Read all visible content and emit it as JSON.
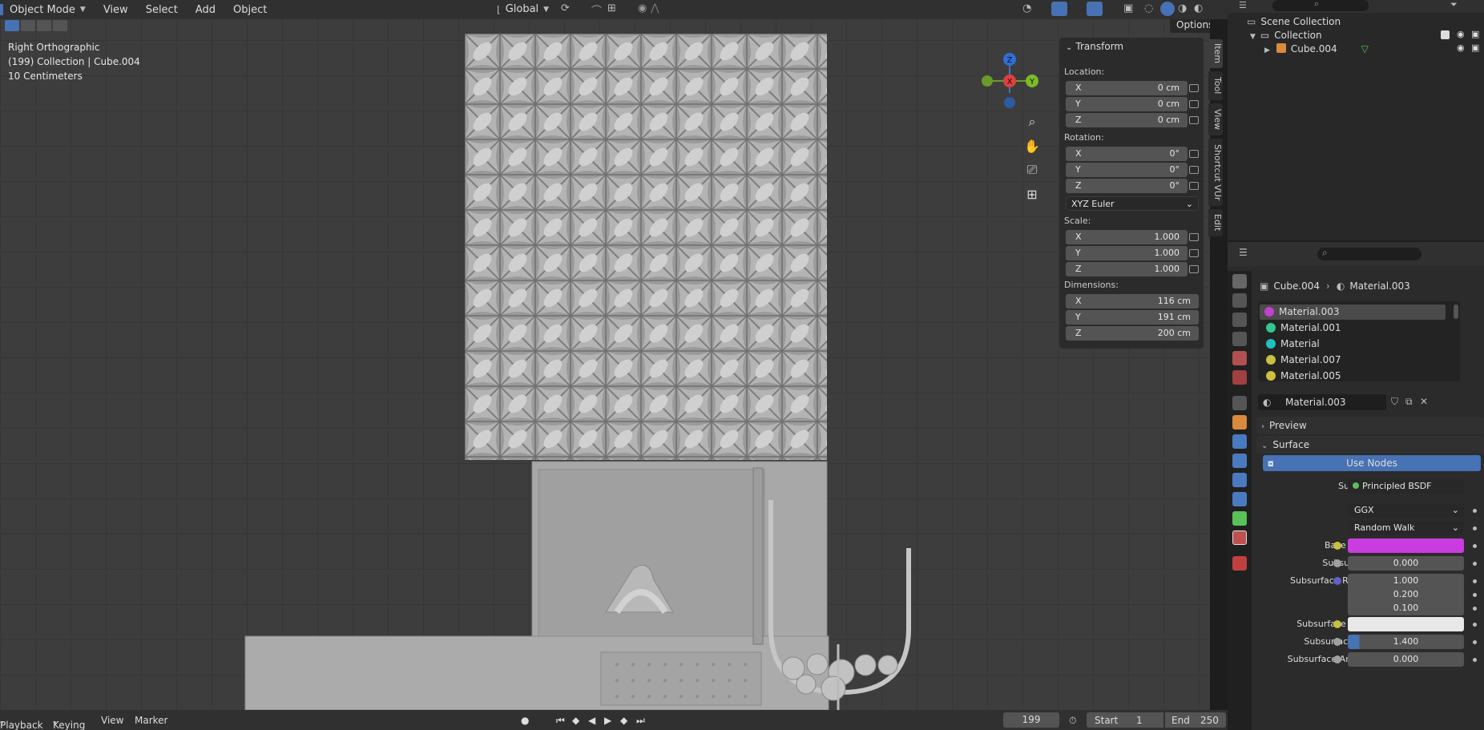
{
  "header": {
    "mode": "Object Mode",
    "menus": [
      "View",
      "Select",
      "Add",
      "Object"
    ],
    "orientation": "Global",
    "options_label": "Options"
  },
  "viewport": {
    "view_name": "Right Orthographic",
    "collection_info": "(199) Collection | Cube.004",
    "scale_info": "10 Centimeters",
    "axes": {
      "z": "Z",
      "x": "X",
      "y": "Y"
    }
  },
  "npanel": {
    "title": "Transform",
    "location_label": "Location:",
    "location": [
      {
        "axis": "X",
        "value": "0 cm"
      },
      {
        "axis": "Y",
        "value": "0 cm"
      },
      {
        "axis": "Z",
        "value": "0 cm"
      }
    ],
    "rotation_label": "Rotation:",
    "rotation": [
      {
        "axis": "X",
        "value": "0°"
      },
      {
        "axis": "Y",
        "value": "0°"
      },
      {
        "axis": "Z",
        "value": "0°"
      }
    ],
    "rotation_mode": "XYZ Euler",
    "scale_label": "Scale:",
    "scale": [
      {
        "axis": "X",
        "value": "1.000"
      },
      {
        "axis": "Y",
        "value": "1.000"
      },
      {
        "axis": "Z",
        "value": "1.000"
      }
    ],
    "dimensions_label": "Dimensions:",
    "dimensions": [
      {
        "axis": "X",
        "value": "116 cm"
      },
      {
        "axis": "Y",
        "value": "191 cm"
      },
      {
        "axis": "Z",
        "value": "200 cm"
      }
    ],
    "tabs": [
      "Item",
      "Tool",
      "View",
      "Shortcut VUr",
      "Edit"
    ]
  },
  "outliner": {
    "scene_collection": "Scene Collection",
    "collection": "Collection",
    "object": "Cube.004"
  },
  "properties": {
    "breadcrumb_object": "Cube.004",
    "breadcrumb_material": "Material.003",
    "materials": [
      {
        "name": "Material.003",
        "color": "#c040d0"
      },
      {
        "name": "Material.001",
        "color": "#30c890"
      },
      {
        "name": "Material",
        "color": "#20c0c0"
      },
      {
        "name": "Material.007",
        "color": "#c8c040"
      },
      {
        "name": "Material.005",
        "color": "#d0c040"
      }
    ],
    "active_material": "Material.003",
    "preview_label": "Preview",
    "surface_panel_label": "Surface",
    "use_nodes_label": "Use Nodes",
    "surface_label": "Surface",
    "surface_shader": "Principled BSDF",
    "distribution": "GGX",
    "subsurface_method": "Random Walk",
    "base_color_label": "Base Color",
    "base_color": "#c93ce0",
    "subsurface_label": "Subsurface",
    "subsurface_value": "0.000",
    "subsurface_radius_label": "Subsurface Radius",
    "subsurface_radius": [
      "1.000",
      "0.200",
      "0.100"
    ],
    "subsurface_color_label": "Subsurface Color",
    "subsurface_color": "#e8e8e8",
    "subsurface_ior_label": "Subsurface IOR",
    "subsurface_ior": "1.400",
    "subsurface_aniso_label": "Subsurface Aniso...",
    "subsurface_aniso": "0.000"
  },
  "timeline": {
    "playback": "Playback",
    "keying": "Keying",
    "view": "View",
    "marker": "Marker",
    "current_frame": "199",
    "start_label": "Start",
    "start_value": "1",
    "end_label": "End",
    "end_value": "250"
  }
}
